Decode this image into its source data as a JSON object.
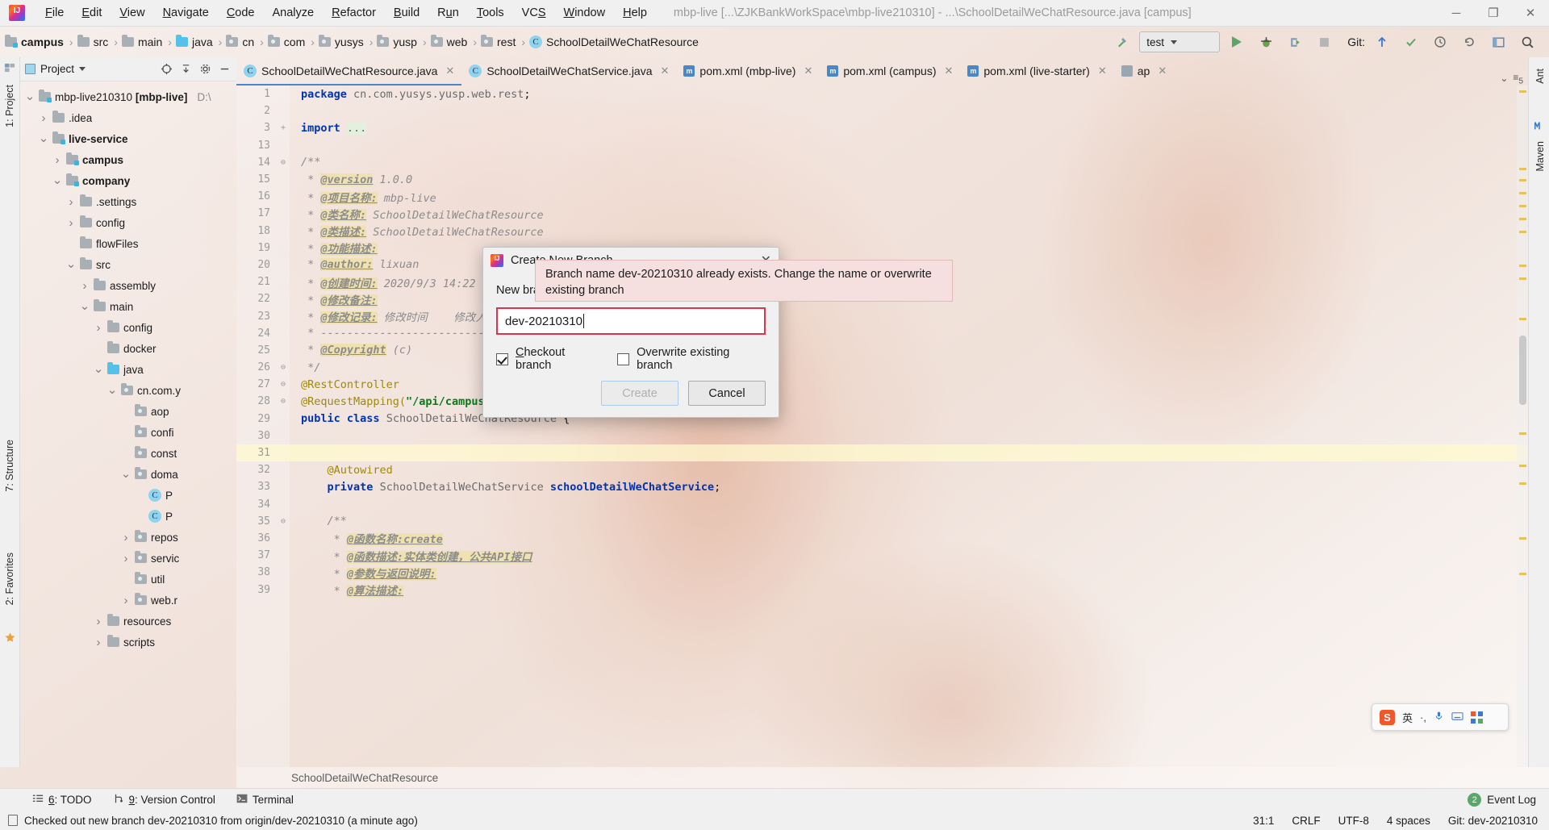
{
  "window": {
    "title": "mbp-live [...\\ZJKBankWorkSpace\\mbp-live210310] - ...\\SchoolDetailWeChatResource.java [campus]",
    "minimize": "─",
    "restore": "❐",
    "close": "✕"
  },
  "menu": {
    "items": [
      "File",
      "Edit",
      "View",
      "Navigate",
      "Code",
      "Analyze",
      "Refactor",
      "Build",
      "Run",
      "Tools",
      "VCS",
      "Window",
      "Help"
    ]
  },
  "navbar": {
    "breadcrumbs": [
      {
        "label": "campus",
        "icon": "module-folder-icon",
        "bold": true
      },
      {
        "label": "src",
        "icon": "folder-icon",
        "bold": false
      },
      {
        "label": "main",
        "icon": "folder-icon",
        "bold": false
      },
      {
        "label": "java",
        "icon": "source-folder-icon",
        "bold": false
      },
      {
        "label": "cn",
        "icon": "package-icon",
        "bold": false
      },
      {
        "label": "com",
        "icon": "package-icon",
        "bold": false
      },
      {
        "label": "yusys",
        "icon": "package-icon",
        "bold": false
      },
      {
        "label": "yusp",
        "icon": "package-icon",
        "bold": false
      },
      {
        "label": "web",
        "icon": "package-icon",
        "bold": false
      },
      {
        "label": "rest",
        "icon": "package-icon",
        "bold": false
      },
      {
        "label": "SchoolDetailWeChatResource",
        "icon": "class-icon",
        "bold": false
      }
    ],
    "run_config": "test",
    "git_label": "Git:",
    "icons": [
      "build-hammer-icon",
      "run-icon",
      "debug-icon",
      "run-with-coverage-icon",
      "stop-icon",
      "git-update-icon",
      "git-commit-icon",
      "git-history-icon",
      "git-rollback-icon",
      "open-settings-icon",
      "search-everywhere-icon"
    ]
  },
  "left_strip": {
    "tabs": [
      "1: Project",
      "7: Structure",
      "2: Favorites"
    ]
  },
  "right_strip": {
    "tabs": [
      "Ant",
      "Maven"
    ]
  },
  "project_panel": {
    "title": "Project",
    "toolbar_icons": [
      "project-view-selector-icon",
      "locate-icon",
      "collapse-all-icon",
      "settings-gear-icon",
      "hide-icon"
    ],
    "tree": [
      {
        "label": "mbp-live210310 [mbp-live]",
        "suffix": "D:\\",
        "depth": 0,
        "arrow": "down",
        "icon": "module-folder-icon",
        "bold_part": "[mbp-live]"
      },
      {
        "label": ".idea",
        "depth": 1,
        "arrow": "right",
        "icon": "folder-icon"
      },
      {
        "label": "live-service",
        "depth": 1,
        "arrow": "down",
        "icon": "module-folder-icon",
        "bold": true
      },
      {
        "label": "campus",
        "depth": 2,
        "arrow": "right",
        "icon": "module-folder-icon",
        "bold": true
      },
      {
        "label": "company",
        "depth": 2,
        "arrow": "down",
        "icon": "module-folder-icon",
        "bold": true
      },
      {
        "label": ".settings",
        "depth": 3,
        "arrow": "right",
        "icon": "folder-icon"
      },
      {
        "label": "config",
        "depth": 3,
        "arrow": "right",
        "icon": "folder-icon"
      },
      {
        "label": "flowFiles",
        "depth": 3,
        "arrow": "none",
        "icon": "folder-icon"
      },
      {
        "label": "src",
        "depth": 3,
        "arrow": "down",
        "icon": "folder-icon"
      },
      {
        "label": "assembly",
        "depth": 4,
        "arrow": "right",
        "icon": "folder-icon"
      },
      {
        "label": "main",
        "depth": 4,
        "arrow": "down",
        "icon": "folder-icon"
      },
      {
        "label": "config",
        "depth": 5,
        "arrow": "right",
        "icon": "folder-icon"
      },
      {
        "label": "docker",
        "depth": 5,
        "arrow": "none",
        "icon": "folder-icon"
      },
      {
        "label": "java",
        "depth": 5,
        "arrow": "down",
        "icon": "source-folder-icon"
      },
      {
        "label": "cn.com.y",
        "depth": 6,
        "arrow": "down",
        "icon": "package-icon"
      },
      {
        "label": "aop",
        "depth": 7,
        "arrow": "none",
        "icon": "package-icon"
      },
      {
        "label": "confi",
        "depth": 7,
        "arrow": "none",
        "icon": "package-icon"
      },
      {
        "label": "const",
        "depth": 7,
        "arrow": "none",
        "icon": "package-icon"
      },
      {
        "label": "doma",
        "depth": 7,
        "arrow": "down",
        "icon": "package-icon"
      },
      {
        "label": "P",
        "depth": 8,
        "arrow": "none",
        "icon": "class-icon"
      },
      {
        "label": "P",
        "depth": 8,
        "arrow": "none",
        "icon": "class-icon"
      },
      {
        "label": "repos",
        "depth": 7,
        "arrow": "right",
        "icon": "package-icon"
      },
      {
        "label": "servic",
        "depth": 7,
        "arrow": "right",
        "icon": "package-icon"
      },
      {
        "label": "util",
        "depth": 7,
        "arrow": "none",
        "icon": "package-icon"
      },
      {
        "label": "web.r",
        "depth": 7,
        "arrow": "right",
        "icon": "package-icon"
      },
      {
        "label": "resources",
        "depth": 5,
        "arrow": "right",
        "icon": "folder-icon"
      },
      {
        "label": "scripts",
        "depth": 5,
        "arrow": "right",
        "icon": "folder-icon"
      }
    ]
  },
  "editor_tabs": [
    {
      "label": "SchoolDetailWeChatResource.java",
      "icon": "java-class-icon",
      "active": true
    },
    {
      "label": "SchoolDetailWeChatService.java",
      "icon": "java-class-icon",
      "active": false
    },
    {
      "label": "pom.xml (mbp-live)",
      "icon": "maven-icon",
      "active": false
    },
    {
      "label": "pom.xml (campus)",
      "icon": "maven-icon",
      "active": false
    },
    {
      "label": "pom.xml (live-starter)",
      "icon": "maven-icon",
      "active": false
    },
    {
      "label": "ap",
      "icon": "file-icon",
      "active": false
    }
  ],
  "editor": {
    "lines": [
      {
        "num": "1",
        "fold": "",
        "html": "<span class='kw'>package</span> <span class='ident'>cn.com.yusys.yusp.web.rest</span>;"
      },
      {
        "num": "2",
        "fold": "",
        "html": ""
      },
      {
        "num": "3",
        "fold": "+",
        "html": "<span class='kw'>import</span> <span class='foldtxt'>...</span>"
      },
      {
        "num": "13",
        "fold": "",
        "html": ""
      },
      {
        "num": "14",
        "fold": "⊖",
        "html": "<span class='cm'>/**</span>"
      },
      {
        "num": "15",
        "fold": "",
        "html": "<span class='cm'> * </span><span class='cmhl'>@version</span><span class='cm'> 1.0.0</span>"
      },
      {
        "num": "16",
        "fold": "",
        "html": "<span class='cm'> * </span><span class='cmhl'>@项目名称:</span><span class='cm'> mbp-live</span>"
      },
      {
        "num": "17",
        "fold": "",
        "html": "<span class='cm'> * </span><span class='cmhl'>@类名称:</span><span class='cm'> SchoolDetailWeChatResource</span>"
      },
      {
        "num": "18",
        "fold": "",
        "html": "<span class='cm'> * </span><span class='cmhl'>@类描述:</span><span class='cm'> SchoolDetailWeChatResource</span>"
      },
      {
        "num": "19",
        "fold": "",
        "html": "<span class='cm'> * </span><span class='cmhl'>@功能描述:</span>"
      },
      {
        "num": "20",
        "fold": "",
        "html": "<span class='cm'> * </span><span class='cmhl'>@author:</span><span class='cm'> lixuan</span>"
      },
      {
        "num": "21",
        "fold": "",
        "html": "<span class='cm'> * </span><span class='cmhl'>@创建时间:</span><span class='cm'> 2020/9/3 14:22</span>"
      },
      {
        "num": "22",
        "fold": "",
        "html": "<span class='cm'> * </span><span class='cmhl'>@修改备注:</span>"
      },
      {
        "num": "23",
        "fold": "",
        "html": "<span class='cm'> * </span><span class='cmhl'>@修改记录:</span><span class='cm'> 修改时间    修改人员</span>"
      },
      {
        "num": "24",
        "fold": "",
        "html": "<span class='cm'> * ----------------------------</span>"
      },
      {
        "num": "25",
        "fold": "",
        "html": "<span class='cm'> * </span><span class='cmhl'>@Copyright</span><span class='cm'> (c)</span>"
      },
      {
        "num": "26",
        "fold": "⊖",
        "html": "<span class='cm'> */</span>"
      },
      {
        "num": "27",
        "fold": "⊖",
        "html": "<span class='anno'>@RestController</span>"
      },
      {
        "num": "28",
        "fold": "⊖",
        "html": "<span class='anno'>@RequestMapping(</span><span class='str'>\"/api/campus\"</span><span class='anno'>)</span>"
      },
      {
        "num": "29",
        "fold": "",
        "html": "<span class='kw'>public class</span> <span class='ident'>SchoolDetailWeChatResource</span> {"
      },
      {
        "num": "30",
        "fold": "",
        "html": ""
      },
      {
        "num": "31",
        "fold": "",
        "html": "",
        "highlight": true
      },
      {
        "num": "32",
        "fold": "",
        "html": "    <span class='anno'>@Autowired</span>"
      },
      {
        "num": "33",
        "fold": "",
        "html": "    <span class='kw'>private</span> <span class='ident'>SchoolDetailWeChatService</span> <span class='kw'>schoolDetailWeChatService</span>;"
      },
      {
        "num": "34",
        "fold": "",
        "html": ""
      },
      {
        "num": "35",
        "fold": "⊖",
        "html": "    <span class='cm'>/**</span>"
      },
      {
        "num": "36",
        "fold": "",
        "html": "     <span class='cm'>* </span><span class='cmhl'>@函数名称:create</span>"
      },
      {
        "num": "37",
        "fold": "",
        "html": "     <span class='cm'>* </span><span class='cmhl'>@函数描述:实体类创建，公共API接口</span>"
      },
      {
        "num": "38",
        "fold": "",
        "html": "     <span class='cm'>* </span><span class='cmhl'>@参数与返回说明:</span>"
      },
      {
        "num": "39",
        "fold": "",
        "html": "     <span class='cm'>* </span><span class='cmhl'>@算法描述:</span>"
      }
    ],
    "breadcrumb": "SchoolDetailWeChatResource"
  },
  "dialog": {
    "title": "Create New Branch",
    "close_label": "✕",
    "field_label": "New branch name:",
    "input_value": "dev-20210310",
    "checkbox_checkout": "Checkout branch",
    "checkbox_overwrite": "Overwrite existing branch",
    "checkout_checked": true,
    "overwrite_checked": false,
    "button_create": "Create",
    "button_cancel": "Cancel",
    "error_message": "Branch name dev-20210310 already exists. Change the name or overwrite existing branch"
  },
  "bottom_bar": {
    "items": [
      {
        "num": "6",
        "label": ": TODO",
        "icon": "todo-icon"
      },
      {
        "num": "9",
        "label": ": Version Control",
        "icon": "vcs-branch-icon"
      },
      {
        "num": "",
        "label": "Terminal",
        "icon": "terminal-icon"
      }
    ],
    "event_log": {
      "count": "2",
      "label": "Event Log"
    }
  },
  "status_bar": {
    "message": "Checked out new branch dev-20210310 from origin/dev-20210310 (a minute ago)",
    "caret": "31:1",
    "line_sep": "CRLF",
    "encoding": "UTF-8",
    "indent": "4 spaces",
    "git": "Git: dev-20210310"
  },
  "ime": {
    "logo": "S",
    "mode": "英",
    "punct": "·,",
    "mic": "mic-icon",
    "keyboard": "keyboard-icon",
    "grid": "grid-icon"
  },
  "colors": {
    "accent": "#4a86c8",
    "error_border": "#e0324a",
    "error_bg": "#f5dfdf",
    "green": "#59a869",
    "comment": "#8c8c8c",
    "keyword": "#0033b3",
    "string": "#067d17"
  }
}
